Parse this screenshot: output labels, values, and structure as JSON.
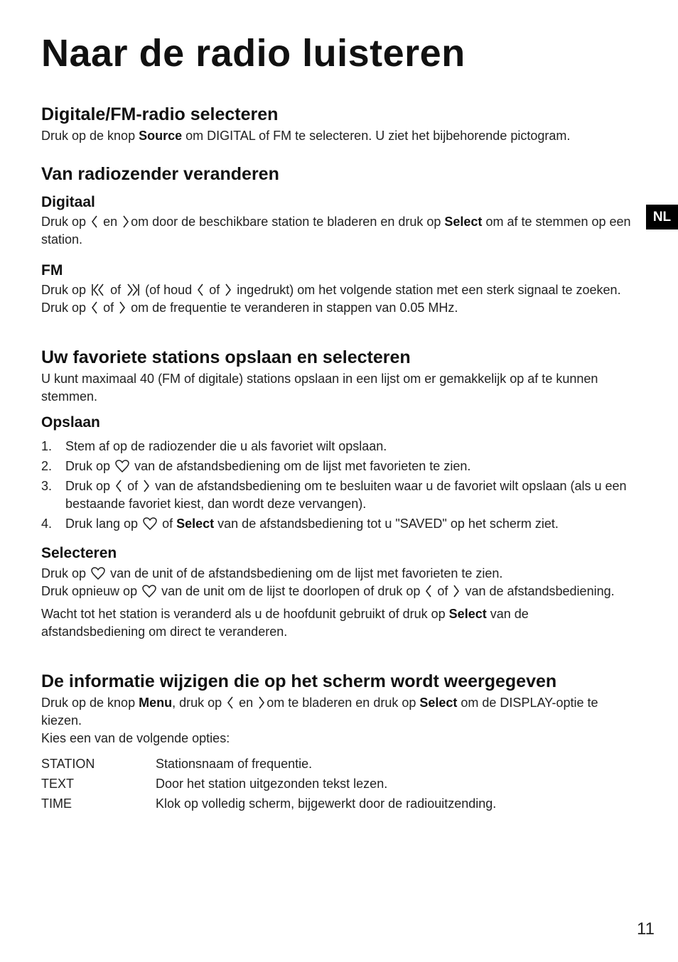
{
  "title": "Naar de radio luisteren",
  "language_tab": "NL",
  "page_number": "11",
  "sections": {
    "select_radio": {
      "heading": "Digitale/FM-radio selecteren",
      "text_pre": "Druk op de knop ",
      "text_bold": "Source",
      "text_post": " om DIGITAL of FM te selecteren. U ziet het bijbehorende pictogram."
    },
    "change_station": {
      "heading": "Van radiozender veranderen",
      "digital": {
        "heading": "Digitaal",
        "t1": "Druk op",
        "t2": "en",
        "t3": "om door de beschikbare station te bladeren en druk op ",
        "bold": "Select",
        "t4": " om af te stemmen op een station."
      },
      "fm": {
        "heading": "FM",
        "l1_a": "Druk op",
        "l1_b": "of",
        "l1_c": "(of houd",
        "l1_d": "of",
        "l1_e": "ingedrukt) om het volgende station met een sterk signaal te zoeken.",
        "l2_a": "Druk op",
        "l2_b": "of",
        "l2_c": "om de frequentie te veranderen in stappen van 0.05 MHz."
      }
    },
    "favorites": {
      "heading": "Uw favoriete stations opslaan en selecteren",
      "intro": "U kunt maximaal 40 (FM of digitale) stations opslaan in een lijst om er gemakkelijk op af te kunnen stemmen.",
      "save": {
        "heading": "Opslaan",
        "steps": [
          {
            "num": "1.",
            "a": "Stem af op de radiozender die u als favoriet wilt opslaan."
          },
          {
            "num": "2.",
            "a": "Druk op",
            "b": "van de afstandsbediening om de lijst met favorieten te zien."
          },
          {
            "num": "3.",
            "a": "Druk op",
            "b": "of",
            "c": "van de afstandsbediening om te besluiten waar u de favoriet wilt opslaan (als u een bestaande favoriet kiest, dan wordt deze vervangen)."
          },
          {
            "num": "4.",
            "a": "Druk lang op",
            "b": "of ",
            "bold": "Select",
            "c": " van de afstandsbediening tot u \"SAVED\" op het scherm ziet."
          }
        ]
      },
      "select": {
        "heading": "Selecteren",
        "p1_a": "Druk op",
        "p1_b": "van de unit of de afstandsbediening om de lijst met favorieten te zien.",
        "p2_a": "Druk opnieuw op",
        "p2_b": "van de unit om de lijst te doorlopen of druk op",
        "p2_c": "of",
        "p2_d": "van de afstandsbediening.",
        "p3_a": "Wacht tot het station is veranderd als u de hoofdunit gebruikt of druk op ",
        "p3_bold": "Select",
        "p3_b": " van de afstandsbediening om direct te veranderen."
      }
    },
    "display": {
      "heading": "De informatie wijzigen die op het scherm wordt weergegeven",
      "p1_a": "Druk op de knop ",
      "p1_bold1": "Menu",
      "p1_b": ", druk op",
      "p1_c": "en",
      "p1_d": "om te bladeren en druk op ",
      "p1_bold2": "Select",
      "p1_e": " om de DISPLAY-optie te kiezen.",
      "p2": "Kies een van de volgende opties:",
      "options": [
        {
          "key": "STATION",
          "desc": "Stationsnaam of frequentie."
        },
        {
          "key": "TEXT",
          "desc": "Door het station uitgezonden tekst lezen."
        },
        {
          "key": "TIME",
          "desc": "Klok op volledig scherm, bijgewerkt door de radiouitzending."
        }
      ]
    }
  }
}
